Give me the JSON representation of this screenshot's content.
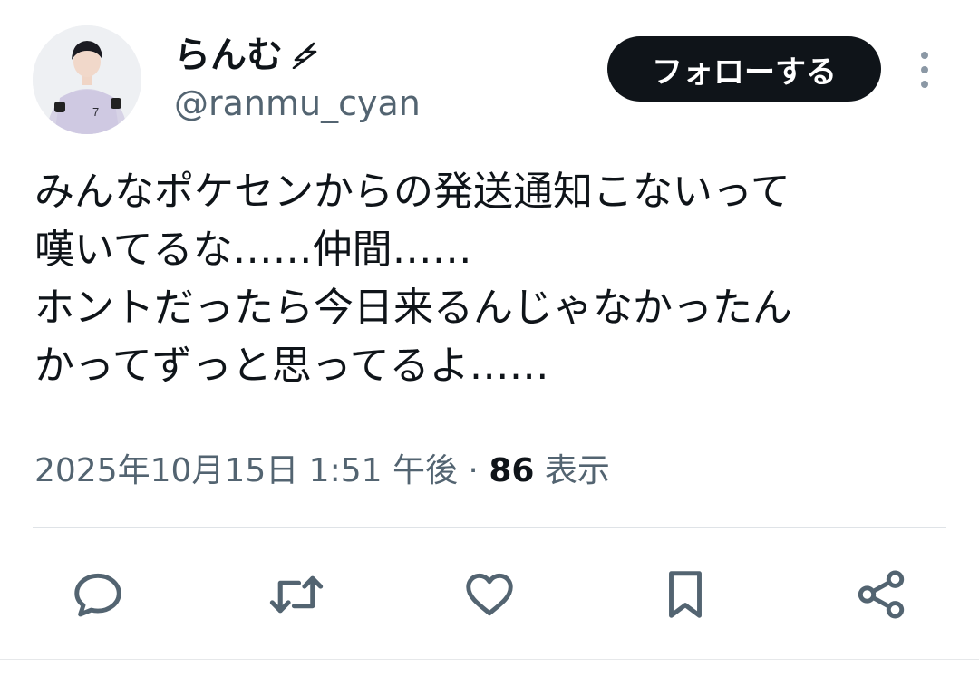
{
  "user": {
    "display_name": "らんむ",
    "handle": "@ranmu_cyan",
    "avatar_jersey_number": "7"
  },
  "follow_label": "フォローする",
  "tweet": {
    "lines": [
      "みんなポケセンからの発送通知こないって",
      "嘆いてるな……仲間……",
      "ホントだったら今日来るんじゃなかったん",
      "かってずっと思ってるよ……"
    ]
  },
  "meta": {
    "timestamp": "2025年10月15日 1:51 午後",
    "separator": "·",
    "views_count": "86",
    "views_label": "表示"
  },
  "actions": [
    {
      "icon": "reply-icon"
    },
    {
      "icon": "retweet-icon"
    },
    {
      "icon": "like-icon"
    },
    {
      "icon": "bookmark-icon"
    },
    {
      "icon": "share-icon"
    }
  ],
  "colors": {
    "text": "#0f1419",
    "secondary": "#536471",
    "button_bg": "#0f1419",
    "divider": "#dfe3e7"
  }
}
